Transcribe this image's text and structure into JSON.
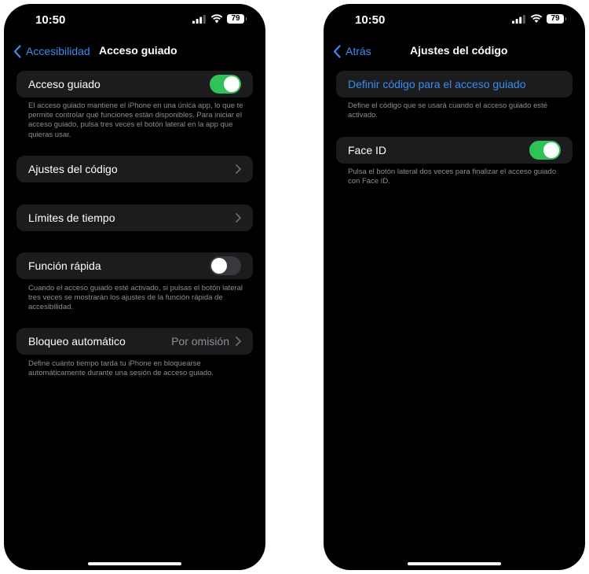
{
  "left_screen": {
    "status_bar": {
      "time": "10:50",
      "battery": "79"
    },
    "nav": {
      "back_label": "Accesibilidad",
      "title": "Acceso guiado"
    },
    "guided_access": {
      "label": "Acceso guiado",
      "toggle_on": true,
      "footer": "El acceso guiado mantiene el iPhone en una única app, lo que te permite controlar qué funciones están disponibles. Para iniciar el acceso guiado, pulsa tres veces el botón lateral en la app que quieras usar."
    },
    "passcode_settings": {
      "label": "Ajustes del código"
    },
    "time_limits": {
      "label": "Límites de tiempo"
    },
    "accessibility_shortcut": {
      "label": "Función rápida",
      "toggle_on": false,
      "footer": "Cuando el acceso guiado esté activado, si pulsas el botón lateral tres veces se mostrarán los ajustes de la función rápida de accesibilidad."
    },
    "auto_lock": {
      "label": "Bloqueo automático",
      "value": "Por omisión",
      "footer": "Define cuánto tiempo tarda tu iPhone en bloquearse automáticamente durante una sesión de acceso guiado."
    }
  },
  "right_screen": {
    "status_bar": {
      "time": "10:50",
      "battery": "79"
    },
    "nav": {
      "back_label": "Atrás",
      "title": "Ajustes del código"
    },
    "set_passcode": {
      "label": "Definir código para el acceso guiado",
      "footer": "Define el código que se usará cuando el acceso guiado esté activado."
    },
    "face_id": {
      "label": "Face ID",
      "toggle_on": true,
      "footer": "Pulsa el botón lateral dos veces para finalizar el acceso guiado con Face ID."
    }
  },
  "colors": {
    "background": "#000000",
    "cell": "#1c1c1e",
    "accent": "#3a8cf0",
    "toggle_on": "#30c158",
    "toggle_off": "#39393d",
    "secondary_text": "#8e8e93"
  }
}
